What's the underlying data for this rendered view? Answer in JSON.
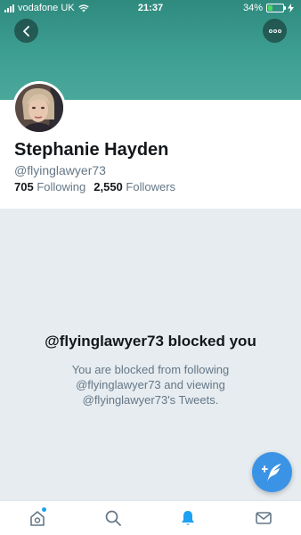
{
  "status_bar": {
    "carrier": "vodafone UK",
    "time": "21:37",
    "battery": "34%",
    "battery_level": 0.34
  },
  "colors": {
    "banner": "#3d9f92",
    "accent": "#1da1f2",
    "fab": "#3b93e6",
    "battery_fill": "#4cd964"
  },
  "header": {
    "back_icon": "chevron-left-icon",
    "more_icon": "more-horizontal-icon"
  },
  "profile": {
    "name": "Stephanie Hayden",
    "handle": "@flyinglawyer73",
    "following_count": "705",
    "following_label": "Following",
    "followers_count": "2,550",
    "followers_label": "Followers"
  },
  "blocked": {
    "title": "@flyinglawyer73 blocked you",
    "description": "You are blocked from following @flyinglawyer73 and viewing @flyinglawyer73's Tweets."
  },
  "fab": {
    "icon": "compose-tweet-icon"
  },
  "nav": {
    "items": [
      {
        "icon": "home-icon"
      },
      {
        "icon": "search-icon"
      },
      {
        "icon": "notifications-bell-icon"
      },
      {
        "icon": "messages-mail-icon"
      }
    ]
  }
}
